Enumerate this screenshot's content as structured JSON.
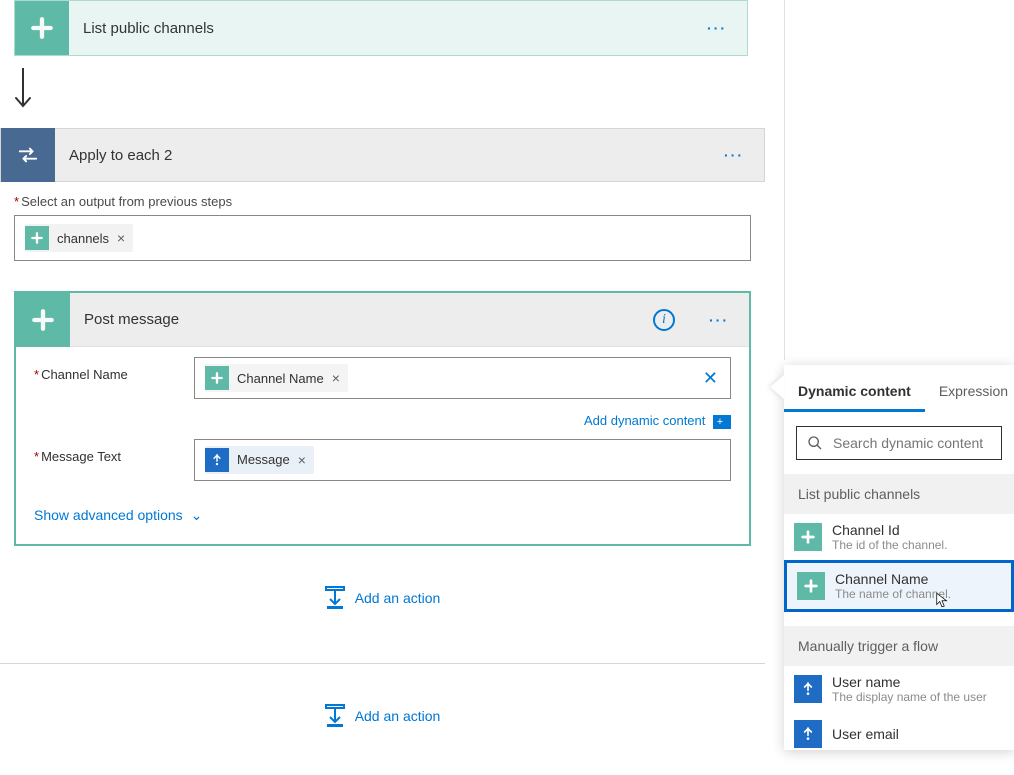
{
  "steps": {
    "listChannels": {
      "title": "List public channels"
    },
    "applyEach": {
      "title": "Apply to each 2"
    },
    "postMessage": {
      "title": "Post message"
    }
  },
  "applyEach": {
    "outputLabel": "Select an output from previous steps",
    "outputToken": "channels"
  },
  "postMessage": {
    "channelNameLabel": "Channel Name",
    "channelNameToken": "Channel Name",
    "messageTextLabel": "Message Text",
    "messageToken": "Message",
    "addDynamic": "Add dynamic content",
    "advancedOptions": "Show advanced options"
  },
  "addAction": "Add an action",
  "dynPanel": {
    "tabs": {
      "dynamic": "Dynamic content",
      "expression": "Expression"
    },
    "searchPlaceholder": "Search dynamic content",
    "sections": {
      "listChannels": {
        "title": "List public channels",
        "items": [
          {
            "title": "Channel Id",
            "desc": "The id of the channel."
          },
          {
            "title": "Channel Name",
            "desc": "The name of channel."
          }
        ]
      },
      "manualTrigger": {
        "title": "Manually trigger a flow",
        "items": [
          {
            "title": "User name",
            "desc": "The display name of the user"
          },
          {
            "title": "User email",
            "desc": ""
          }
        ]
      }
    }
  }
}
